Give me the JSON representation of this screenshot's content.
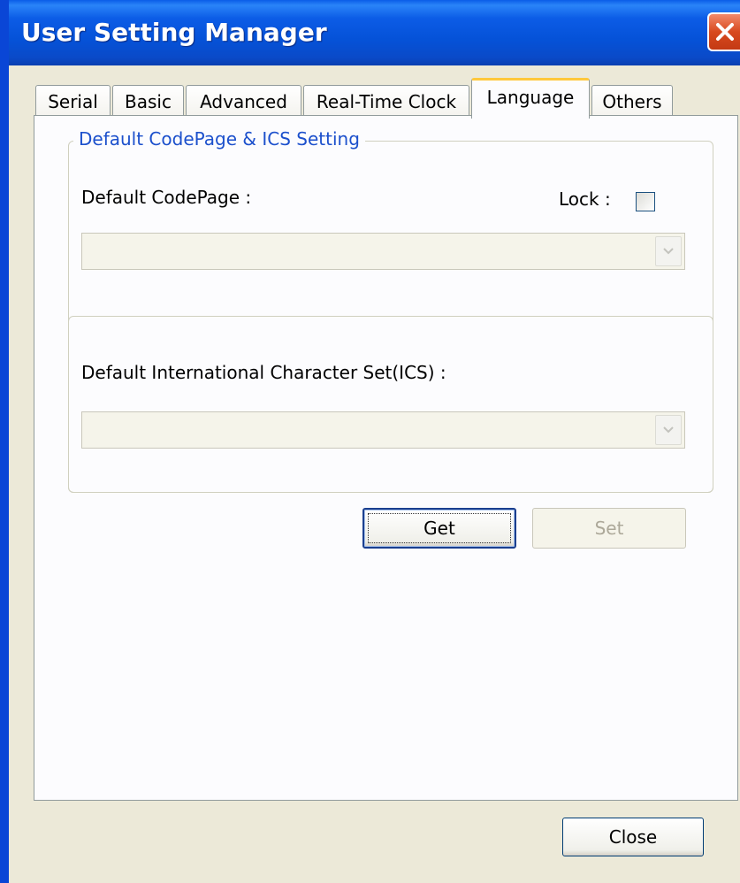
{
  "window": {
    "title": "User Setting Manager"
  },
  "tabs": [
    {
      "label": "Serial",
      "active": false
    },
    {
      "label": "Basic",
      "active": false
    },
    {
      "label": "Advanced",
      "active": false
    },
    {
      "label": "Real-Time Clock",
      "active": false
    },
    {
      "label": "Language",
      "active": true
    },
    {
      "label": "Others",
      "active": false
    }
  ],
  "language": {
    "group_title": "Default CodePage & ICS Setting",
    "codepage_label": "Default CodePage  :",
    "lock_label": "Lock :",
    "lock_checked": false,
    "codepage_value": "",
    "ics_label": "Default International Character Set(ICS) :",
    "ics_value": ""
  },
  "buttons": {
    "get": "Get",
    "set": "Set",
    "close": "Close"
  },
  "colors": {
    "titlebar": "#0552d8",
    "window_bg": "#ece9d8",
    "group_title": "#1c50cc",
    "active_tab_accent": "#ffc83c",
    "close_button": "#d8491e"
  },
  "icons": {
    "close": "close-icon",
    "dropdown": "chevron-down-icon"
  }
}
